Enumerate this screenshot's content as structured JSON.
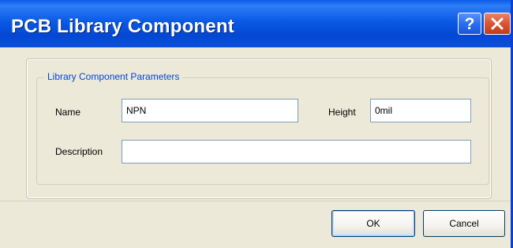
{
  "window": {
    "title": "PCB Library Component",
    "help_glyph": "?",
    "close_icon": "close-icon",
    "help_icon": "help-icon",
    "colors": {
      "titlebar": "#0a5ae6",
      "face": "#ece9d8",
      "group_label": "#0046d5",
      "close": "#dc5431"
    }
  },
  "group": {
    "label": "Library Component Parameters"
  },
  "fields": {
    "name_label": "Name",
    "name_value": "NPN",
    "height_label": "Height",
    "height_value": "0mil",
    "description_label": "Description",
    "description_value": ""
  },
  "buttons": {
    "ok_label": "OK",
    "cancel_label": "Cancel"
  }
}
